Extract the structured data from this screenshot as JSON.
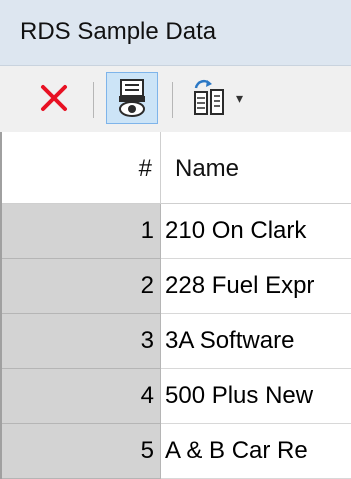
{
  "window": {
    "title": "RDS Sample Data"
  },
  "toolbar": {
    "buttons": [
      {
        "icon": "close-icon",
        "color": "#e81123"
      },
      {
        "icon": "record-view-icon",
        "active": true
      },
      {
        "icon": "export-icon",
        "has_dropdown": true
      }
    ]
  },
  "grid": {
    "columns": [
      "#",
      "Name"
    ],
    "rows": [
      {
        "num": "1",
        "name": "210 On Clark"
      },
      {
        "num": "2",
        "name": "228 Fuel Expr"
      },
      {
        "num": "3",
        "name": "3A Software"
      },
      {
        "num": "4",
        "name": "500 Plus New"
      },
      {
        "num": "5",
        "name": "A & B Car Re"
      }
    ]
  },
  "colors": {
    "titlebar": "#dde6f0",
    "toolbar": "#f0f0f0",
    "active_button": "#cce4f7",
    "row_header": "#d3d3d3"
  }
}
